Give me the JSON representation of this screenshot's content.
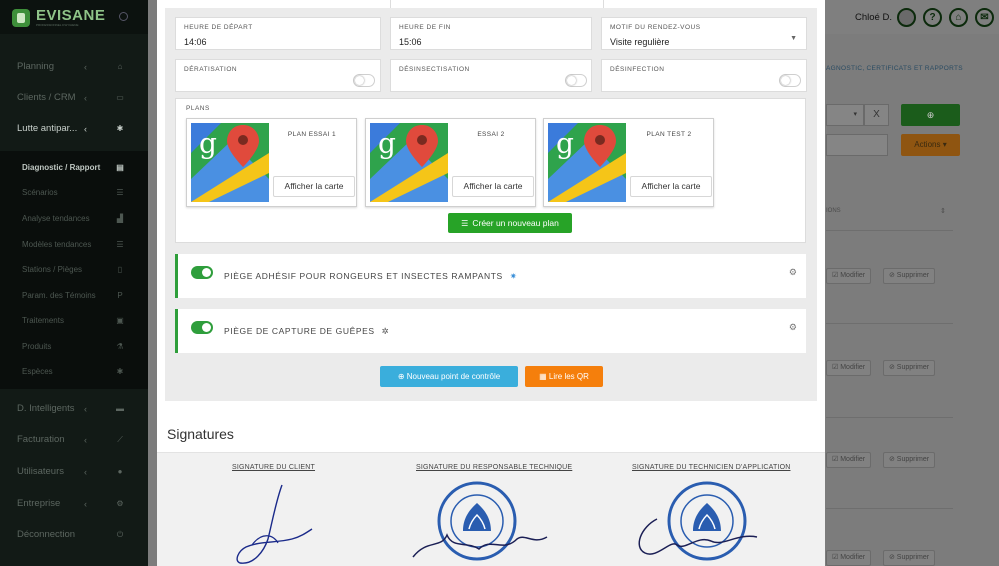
{
  "sidebar": {
    "logo_text": "EVISANE",
    "logo_subtitle": "PROFESSIONNEL D'HYGIENE",
    "items": [
      {
        "label": "Planning",
        "icon": "home-icon"
      },
      {
        "label": "Clients / CRM",
        "icon": "id-card-icon"
      },
      {
        "label": "Lutte antipar...",
        "icon": "bug-icon"
      }
    ],
    "subitems": [
      {
        "label": "Diagnostic / Rapport",
        "icon": "clipboard-icon"
      },
      {
        "label": "Scénarios",
        "icon": "list-icon"
      },
      {
        "label": "Analyse tendances",
        "icon": "chart-icon"
      },
      {
        "label": "Modèles tendances",
        "icon": "list-icon"
      },
      {
        "label": "Stations / Pièges",
        "icon": "trash-icon"
      },
      {
        "label": "Param. des Témoins",
        "icon": "p-icon"
      },
      {
        "label": "Traitements",
        "icon": "medkit-icon"
      },
      {
        "label": "Produits",
        "icon": "flask-icon"
      },
      {
        "label": "Espèces",
        "icon": "bug-icon"
      }
    ],
    "items_bottom": [
      {
        "label": "D. Intelligents",
        "icon": "folder-icon"
      },
      {
        "label": "Facturation",
        "icon": "line-chart-icon"
      },
      {
        "label": "Utilisateurs",
        "icon": "user-icon"
      },
      {
        "label": "Entreprise",
        "icon": "gear-icon"
      },
      {
        "label": "Déconnection",
        "icon": "power-icon"
      }
    ]
  },
  "topbar": {
    "username": "Chloé D."
  },
  "background": {
    "breadcrumb": "AGNOSTIC, CERTIFICATS ET RAPPORTS",
    "add_symbol": "⊕",
    "actions_label": "Actions ▾",
    "x_label": "X",
    "col_header": "IONS",
    "row_actions": [
      "☑ Modifier",
      "⊘ Supprimer"
    ]
  },
  "modal": {
    "fields": {
      "start_label": "Heure de départ",
      "start_value": "14:06",
      "end_label": "Heure de fin",
      "end_value": "15:06",
      "reason_label": "Motif du rendez-vous",
      "reason_value": "Visite regulière"
    },
    "toggles": [
      {
        "label": "Dératisation",
        "on": false
      },
      {
        "label": "Désinsectisation",
        "on": false
      },
      {
        "label": "Désinfection",
        "on": false
      }
    ],
    "plans_label": "PLANS",
    "plans": [
      {
        "name": "PLAN ESSAI 1",
        "button": "Afficher la carte"
      },
      {
        "name": "ESSAI 2",
        "button": "Afficher la carte"
      },
      {
        "name": "PLAN TEST 2",
        "button": "Afficher la carte"
      }
    ],
    "new_plan_button": "Créer un nouveau plan",
    "control_points": [
      {
        "label": "PIÈGE ADHÉSIF POUR RONGEURS ET INSECTES RAMPANTS",
        "icon": "bug-icon"
      },
      {
        "label": "PIÈGE DE CAPTURE DE GUÊPES",
        "icon": "wasp-icon"
      }
    ],
    "new_control_point_button": "Nouveau point de contrôle",
    "read_qr_button": "Lire les QR",
    "signatures_title": "Signatures",
    "signatures": [
      {
        "label": "SIGNATURE DU CLIENT"
      },
      {
        "label": "SIGNATURE DU RESPONSABLE TECHNIQUE"
      },
      {
        "label": "SIGNATURE DU TECHNICIEN D'APPLICATION"
      }
    ],
    "colors": {
      "green": "#27a327",
      "blue": "#3aaedc",
      "orange": "#f57f0c"
    }
  }
}
